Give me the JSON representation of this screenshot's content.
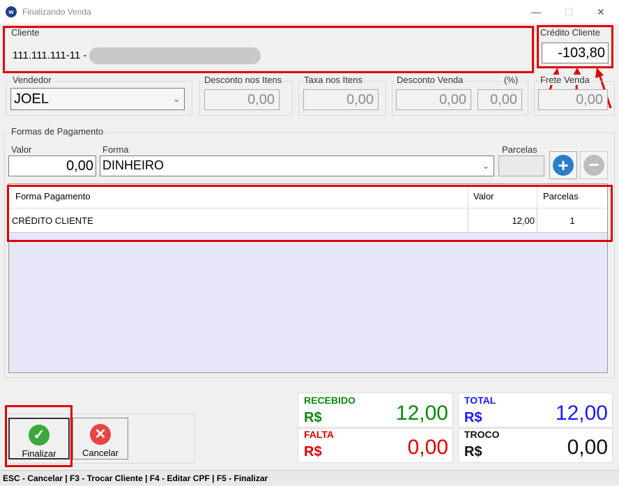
{
  "window": {
    "title": "Finalizando Venda",
    "minimize": "—",
    "maximize": "☐",
    "close": "✕"
  },
  "cliente": {
    "label": "Cliente",
    "value": "111.111.111-11 -"
  },
  "credito": {
    "label": "Crédito Cliente",
    "value": "-103,80"
  },
  "vendedor": {
    "label": "Vendedor",
    "value": "JOEL"
  },
  "desconto_itens": {
    "label": "Desconto nos Itens",
    "value": "0,00"
  },
  "taxa_itens": {
    "label": "Taxa nos Itens",
    "value": "0,00"
  },
  "desconto_venda": {
    "label": "Desconto Venda",
    "pct_label": "(%)",
    "value": "0,00",
    "pct_value": "0,00"
  },
  "frete": {
    "label": "Frete Venda",
    "value": "0,00"
  },
  "pagamento": {
    "title": "Formas de Pagamento",
    "valor_label": "Valor",
    "valor": "0,00",
    "forma_label": "Forma",
    "forma": "DINHEIRO",
    "parcelas_label": "Parcelas",
    "parcelas": ""
  },
  "table": {
    "headers": [
      "Forma Pagamento",
      "Valor",
      "Parcelas"
    ],
    "rows": [
      {
        "forma": "CRÉDITO CLIENTE",
        "valor": "12,00",
        "parcelas": "1"
      }
    ]
  },
  "summary": {
    "recebido": {
      "label": "RECEBIDO",
      "cur": "R$",
      "value": "12,00"
    },
    "total": {
      "label": "TOTAL",
      "cur": "R$",
      "value": "12,00"
    },
    "falta": {
      "label": "FALTA",
      "cur": "R$",
      "value": "0,00"
    },
    "troco": {
      "label": "TROCO",
      "cur": "R$",
      "value": "0,00"
    }
  },
  "buttons": {
    "finalizar": "Finalizar",
    "cancelar": "Cancelar"
  },
  "statusbar": "ESC - Cancelar | F3 - Trocar Cliente | F4 - Editar CPF | F5 - Finalizar",
  "colors": {
    "recebido": "#0a8a0a",
    "total": "#1a1aff",
    "falta": "#e00000",
    "annotation": "#e00000",
    "add": "#2a7fc8"
  },
  "icons": {
    "add": "plus-icon",
    "remove": "minus-icon",
    "finalizar": "check-icon",
    "cancelar": "x-icon"
  }
}
